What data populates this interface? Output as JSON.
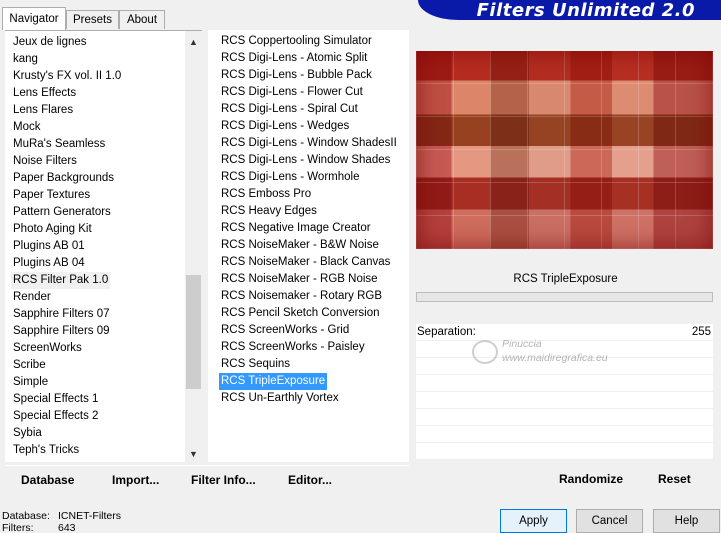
{
  "tabs": [
    "Navigator",
    "Presets",
    "About"
  ],
  "banner": "Filters Unlimited 2.0",
  "categories": [
    "Jeux de lignes",
    "kang",
    "Krusty's FX vol. II 1.0",
    "Lens Effects",
    "Lens Flares",
    "Mock",
    "MuRa's Seamless",
    "Noise Filters",
    "Paper Backgrounds",
    "Paper Textures",
    "Pattern Generators",
    "Photo Aging Kit",
    "Plugins AB 01",
    "Plugins AB 04",
    "RCS Filter Pak 1.0",
    "Render",
    "Sapphire Filters 07",
    "Sapphire Filters 09",
    "ScreenWorks",
    "Scribe",
    "Simple",
    "Special Effects 1",
    "Special Effects 2",
    "Sybia",
    "Teph's Tricks"
  ],
  "filters": [
    "RCS Coppertooling Simulator",
    "RCS Digi-Lens - Atomic Split",
    "RCS Digi-Lens - Bubble Pack",
    "RCS Digi-Lens - Flower Cut",
    "RCS Digi-Lens - Spiral Cut",
    "RCS Digi-Lens - Wedges",
    "RCS Digi-Lens - Window ShadesII",
    "RCS Digi-Lens - Window Shades",
    "RCS Digi-Lens - Wormhole",
    "RCS Emboss Pro",
    "RCS Heavy Edges",
    "RCS Negative Image Creator",
    "RCS NoiseMaker - B&W Noise",
    "RCS NoiseMaker - Black Canvas",
    "RCS NoiseMaker - RGB Noise",
    "RCS Noisemaker - Rotary RGB",
    "RCS Pencil Sketch Conversion",
    "RCS ScreenWorks - Grid",
    "RCS ScreenWorks - Paisley",
    "RCS Sequins",
    "RCS TripleExposure",
    "RCS Un-Earthly Vortex"
  ],
  "selected_category": "RCS Filter Pak 1.0",
  "selected_filter": "RCS TripleExposure",
  "left_buttons": {
    "database": "Database",
    "import": "Import...",
    "filter_info": "Filter Info...",
    "editor": "Editor..."
  },
  "current_filter_name": "RCS TripleExposure",
  "param": {
    "label": "Separation:",
    "value": "255"
  },
  "watermark": {
    "line1": "Pinuccia",
    "line2": "www.maidiregrafica.eu"
  },
  "right_buttons": {
    "randomize": "Randomize",
    "reset": "Reset"
  },
  "status": {
    "db_label": "Database:",
    "db_value": "ICNET-Filters",
    "filters_label": "Filters:",
    "filters_value": "643"
  },
  "dialog_buttons": {
    "apply": "Apply",
    "cancel": "Cancel",
    "help": "Help"
  },
  "icons": {
    "scroll_up": "chevron-up-icon",
    "scroll_down": "chevron-down-icon"
  },
  "colors": {
    "banner": "#0a1aa8",
    "selection": "#3399ff"
  }
}
